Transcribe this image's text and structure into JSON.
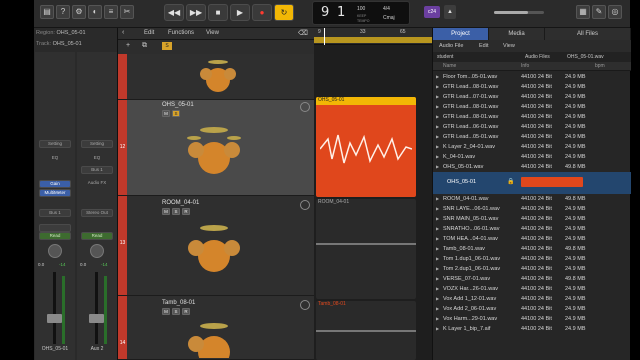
{
  "colors": {
    "accent": "#3b5fa7",
    "region_orange": "#e0471c",
    "region_gray": "#2a2a2a",
    "cycle_yellow": "#f2b705",
    "record_red": "#ff3b30",
    "track_strip_red": "#c0392b"
  },
  "control_bar": {
    "buttons": [
      {
        "name": "library-icon",
        "glyph": "▤"
      },
      {
        "name": "help-icon",
        "glyph": "?"
      },
      {
        "name": "toolbar-icon",
        "glyph": "⚙"
      },
      {
        "name": "smart-controls-icon",
        "glyph": "◐"
      },
      {
        "name": "mixer-icon",
        "glyph": "≡"
      },
      {
        "name": "editors-icon",
        "glyph": "✂"
      }
    ],
    "transport": [
      {
        "name": "rewind-button",
        "glyph": "◀◀"
      },
      {
        "name": "forward-button",
        "glyph": "▶▶"
      },
      {
        "name": "stop-button",
        "glyph": "■"
      },
      {
        "name": "play-button",
        "glyph": "▶"
      },
      {
        "name": "record-button",
        "glyph": "●"
      },
      {
        "name": "cycle-button",
        "glyph": "↻"
      }
    ],
    "lcd": {
      "bar": "9",
      "beat": "1",
      "tempo": "100",
      "tempo_label": "KEEP",
      "tempo_sub": "TEMPO",
      "signature": "4/4",
      "key": "Cmaj"
    },
    "count_in": "c24",
    "metronome_glyph": "▲"
  },
  "inspector": {
    "region_label": "Region:",
    "region_value": "OHS_05-01",
    "track_label": "Track:",
    "track_value": "OHS_05-01",
    "left_strip": {
      "setting": "Setting",
      "eq": "EQ",
      "input": "Gain",
      "plugin": "MultiMeter",
      "send": "Bus 1",
      "mode": "Read",
      "vol": "0.0",
      "pan": "-14",
      "name": "OHS_05-01"
    },
    "right_strip": {
      "setting": "Setting",
      "eq": "EQ",
      "input": "Bus 1",
      "plugin": "Audio FX",
      "send": "",
      "output": "Stereo Out",
      "mode": "Read",
      "vol": "0.0",
      "pan": "-14",
      "name": "Aux 2"
    }
  },
  "tracks_header": {
    "edit": "Edit",
    "functions": "Functions",
    "view": "View"
  },
  "tracks": [
    {
      "name": "",
      "num": "",
      "selected": false
    },
    {
      "name": "OHS_05-01",
      "num": "12",
      "selected": true
    },
    {
      "name": "ROOM_04-01",
      "num": "13",
      "selected": false
    },
    {
      "name": "Tamb_08-01",
      "num": "14",
      "selected": false
    }
  ],
  "mrs": {
    "m": "M",
    "s": "S",
    "r": "R"
  },
  "ruler": {
    "marks": [
      "9",
      "33",
      "65"
    ]
  },
  "regions": [
    {
      "name": "OHS_05-01",
      "color": "#e0471c"
    },
    {
      "name": "ROOM_04-01",
      "color": "#2a2a2a"
    },
    {
      "name": "Tamb_08-01",
      "color": "#2a2a2a"
    }
  ],
  "browser": {
    "tabs": [
      "Project",
      "Media",
      "All Files"
    ],
    "menu": {
      "audio_file": "Audio File",
      "edit": "Edit",
      "view": "View"
    },
    "path": [
      "student",
      "Audio Files",
      "OHS_05-01.wav"
    ],
    "columns": {
      "name": "Name",
      "info": "Info",
      "bpm": "bpm"
    },
    "files": [
      {
        "name": "Floor Tom...05-01.wav",
        "rate": "44100",
        "bits": "24 Bit",
        "size": "24.9 MB"
      },
      {
        "name": "GTR Lead...08-01.wav",
        "rate": "44100",
        "bits": "24 Bit",
        "size": "24.9 MB"
      },
      {
        "name": "GTR Lead...07-01.wav",
        "rate": "44100",
        "bits": "24 Bit",
        "size": "24.9 MB"
      },
      {
        "name": "GTR Lead...08-01.wav",
        "rate": "44100",
        "bits": "24 Bit",
        "size": "24.9 MB"
      },
      {
        "name": "GTR Lead...08-01.wav",
        "rate": "44100",
        "bits": "24 Bit",
        "size": "24.9 MB"
      },
      {
        "name": "GTR Lead...06-01.wav",
        "rate": "44100",
        "bits": "24 Bit",
        "size": "24.9 MB"
      },
      {
        "name": "GTR Lead...05-01.wav",
        "rate": "44100",
        "bits": "24 Bit",
        "size": "24.9 MB"
      },
      {
        "name": "K Layer 2_04-01.wav",
        "rate": "44100",
        "bits": "24 Bit",
        "size": "24.9 MB"
      },
      {
        "name": "K_04-01.wav",
        "rate": "44100",
        "bits": "24 Bit",
        "size": "24.9 MB"
      },
      {
        "name": "OHS_05-01.wav",
        "rate": "44100",
        "bits": "24 Bit",
        "size": "49.8 MB"
      }
    ],
    "expanded_item": {
      "name": "OHS_05-01"
    },
    "files_after": [
      {
        "name": "ROOM_04-01.wav",
        "rate": "44100",
        "bits": "24 Bit",
        "size": "49.8 MB"
      },
      {
        "name": "SNR LAYE...06-01.wav",
        "rate": "44100",
        "bits": "24 Bit",
        "size": "24.9 MB"
      },
      {
        "name": "SNR MAIN_05-01.wav",
        "rate": "44100",
        "bits": "24 Bit",
        "size": "24.9 MB"
      },
      {
        "name": "SNRATHO...06-01.wav",
        "rate": "44100",
        "bits": "24 Bit",
        "size": "24.9 MB"
      },
      {
        "name": "TOM HEA...04-01.wav",
        "rate": "44100",
        "bits": "24 Bit",
        "size": "24.9 MB"
      },
      {
        "name": "Tamb_08-01.wav",
        "rate": "44100",
        "bits": "24 Bit",
        "size": "49.8 MB"
      },
      {
        "name": "Tom 1.dup1_06-01.wav",
        "rate": "44100",
        "bits": "24 Bit",
        "size": "24.9 MB"
      },
      {
        "name": "Tom 2.dup1_06-01.wav",
        "rate": "44100",
        "bits": "24 Bit",
        "size": "24.9 MB"
      },
      {
        "name": "VERSE_07-01.wav",
        "rate": "44100",
        "bits": "24 Bit",
        "size": "49.8 MB"
      },
      {
        "name": "VOZX Har...26-01.wav",
        "rate": "44100",
        "bits": "24 Bit",
        "size": "24.9 MB"
      },
      {
        "name": "Vox Add 1_12-01.wav",
        "rate": "44100",
        "bits": "24 Bit",
        "size": "24.9 MB"
      },
      {
        "name": "Vox Add 2_06-01.wav",
        "rate": "44100",
        "bits": "24 Bit",
        "size": "24.9 MB"
      },
      {
        "name": "Vox Harm...29-01.wav",
        "rate": "44100",
        "bits": "24 Bit",
        "size": "24.9 MB"
      },
      {
        "name": "K Layer 1_bip_7.aif",
        "rate": "44100",
        "bits": "24 Bit",
        "size": "24.9 MB"
      }
    ]
  }
}
